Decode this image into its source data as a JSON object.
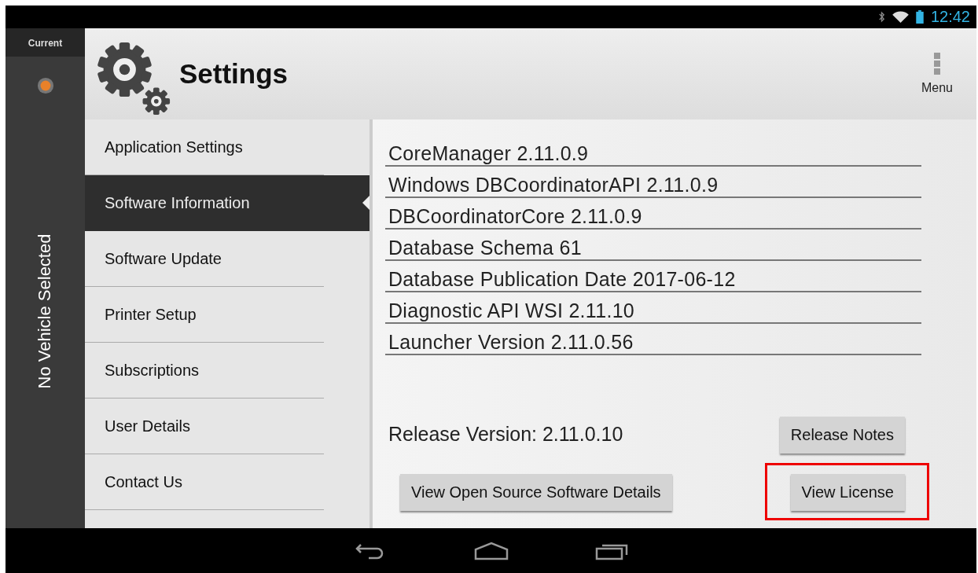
{
  "status_bar": {
    "time": "12:42"
  },
  "rail": {
    "label": "Current",
    "vehicle": "No Vehicle Selected"
  },
  "header": {
    "title": "Settings",
    "menu": "Menu"
  },
  "sidebar": {
    "items": [
      {
        "label": "Application Settings",
        "selected": false
      },
      {
        "label": "Software Information",
        "selected": true
      },
      {
        "label": "Software Update",
        "selected": false
      },
      {
        "label": "Printer Setup",
        "selected": false
      },
      {
        "label": "Subscriptions",
        "selected": false
      },
      {
        "label": "User Details",
        "selected": false
      },
      {
        "label": "Contact Us",
        "selected": false
      }
    ]
  },
  "versions": [
    "CoreManager 2.11.0.9",
    "Windows DBCoordinatorAPI 2.11.0.9",
    "DBCoordinatorCore 2.11.0.9",
    "Database Schema 61",
    "Database Publication Date 2017-06-12",
    "Diagnostic API WSI 2.11.10",
    "Launcher Version 2.11.0.56"
  ],
  "release": "Release Version: 2.11.0.10",
  "buttons": [
    {
      "label": "Release Notes",
      "highlighted": false
    },
    {
      "label": "View Open Source Software Details",
      "highlighted": false
    },
    {
      "label": "View License",
      "highlighted": true
    }
  ]
}
